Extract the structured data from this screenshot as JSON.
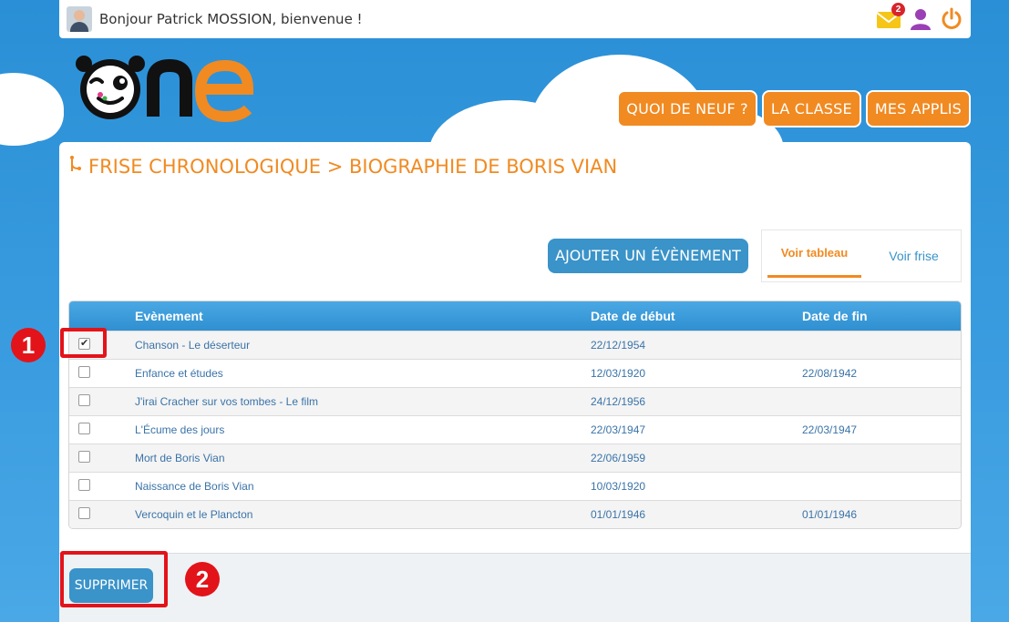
{
  "header": {
    "greeting": "Bonjour Patrick MOSSION, bienvenue !",
    "mail_badge": "2",
    "icons": [
      "mail-icon",
      "user-icon",
      "power-icon"
    ]
  },
  "nav": {
    "quoi_de_neuf": "QUOI DE NEUF ?",
    "la_classe": "LA CLASSE",
    "mes_applis": "MES APPLIS"
  },
  "page": {
    "title": "FRISE CHRONOLOGIQUE > BIOGRAPHIE DE BORIS VIAN",
    "add_button": "AJOUTER UN ÉVÈNEMENT",
    "tab_table": "Voir tableau",
    "tab_frise": "Voir frise",
    "delete_button": "SUPPRIMER"
  },
  "table": {
    "headers": [
      "Evènement",
      "Date de début",
      "Date de fin"
    ],
    "rows": [
      {
        "checked": true,
        "name": "Chanson - Le déserteur",
        "start": "22/12/1954",
        "end": ""
      },
      {
        "checked": false,
        "name": "Enfance et études",
        "start": "12/03/1920",
        "end": "22/08/1942"
      },
      {
        "checked": false,
        "name": "J'irai Cracher sur vos tombes - Le film",
        "start": "24/12/1956",
        "end": ""
      },
      {
        "checked": false,
        "name": "L'Écume des jours",
        "start": "22/03/1947",
        "end": "22/03/1947"
      },
      {
        "checked": false,
        "name": "Mort de Boris Vian",
        "start": "22/06/1959",
        "end": ""
      },
      {
        "checked": false,
        "name": "Naissance de Boris Vian",
        "start": "10/03/1920",
        "end": ""
      },
      {
        "checked": false,
        "name": "Vercoquin et le Plancton",
        "start": "01/01/1946",
        "end": "01/01/1946"
      }
    ]
  },
  "annotations": {
    "marker_1": "1",
    "marker_2": "2"
  },
  "colors": {
    "accent_orange": "#f18a21",
    "primary_blue": "#3a93c9",
    "annotation_red": "#e3131a"
  }
}
